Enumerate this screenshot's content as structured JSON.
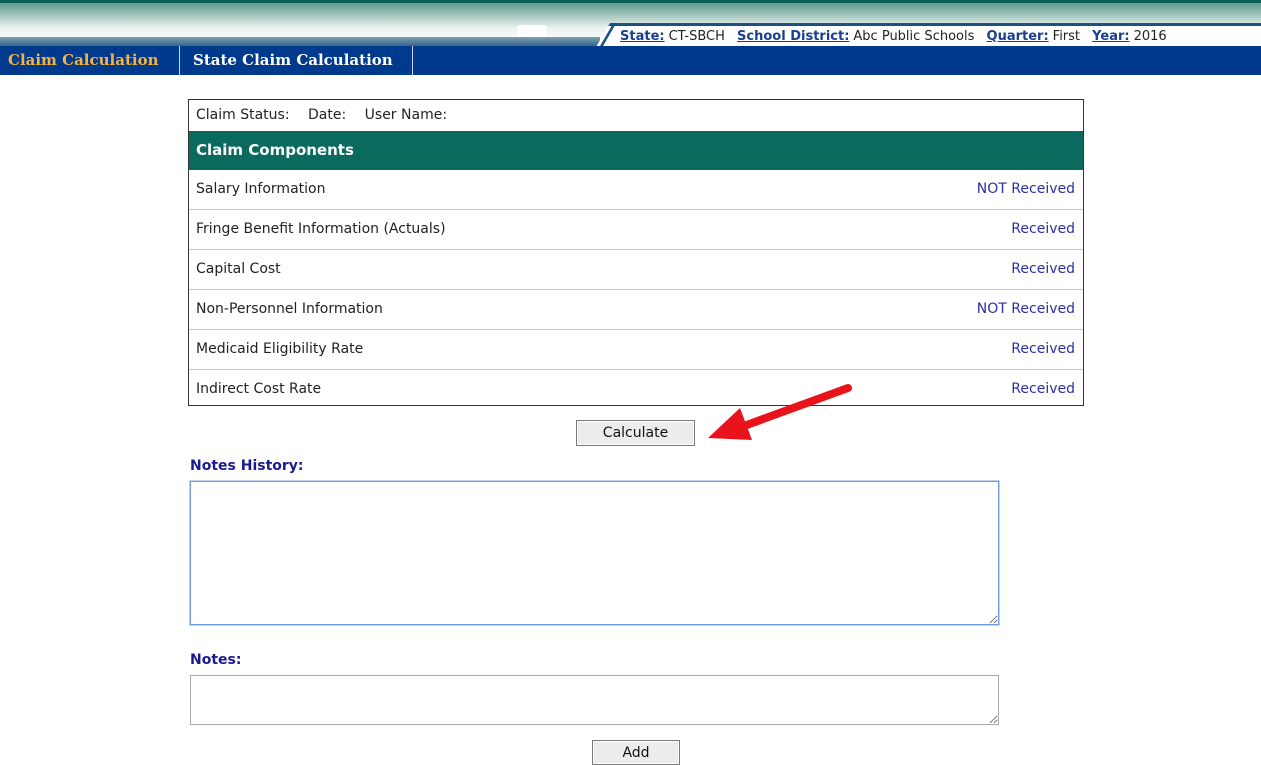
{
  "context": {
    "state_label": "State:",
    "state_value": "CT-SBCH",
    "district_label": "School District:",
    "district_value": "Abc Public Schools",
    "quarter_label": "Quarter:",
    "quarter_value": "First",
    "year_label": "Year:",
    "year_value": "2016"
  },
  "nav": {
    "tabs": [
      {
        "label": "Claim Calculation",
        "active": true
      },
      {
        "label": "State Claim Calculation",
        "active": false
      }
    ]
  },
  "claim": {
    "status_label": "Claim Status:",
    "date_label": "Date:",
    "user_label": "User Name:",
    "components_header": "Claim Components",
    "components": [
      {
        "name": "Salary Information",
        "status": "NOT Received"
      },
      {
        "name": "Fringe Benefit Information (Actuals)",
        "status": "Received"
      },
      {
        "name": "Capital Cost",
        "status": "Received"
      },
      {
        "name": "Non-Personnel Information",
        "status": "NOT Received"
      },
      {
        "name": "Medicaid Eligibility Rate",
        "status": "Received"
      },
      {
        "name": "Indirect Cost Rate",
        "status": "Received"
      }
    ]
  },
  "actions": {
    "calculate_label": "Calculate",
    "add_label": "Add"
  },
  "notes": {
    "history_label": "Notes History:",
    "history_value": "",
    "notes_label": "Notes:",
    "notes_value": ""
  },
  "colors": {
    "nav_bg": "#003a8c",
    "active_tab": "#f5b342",
    "components_header_bg": "#0b6a5e",
    "status_text": "#2b2fa6",
    "annotation_arrow": "#e8131b"
  }
}
